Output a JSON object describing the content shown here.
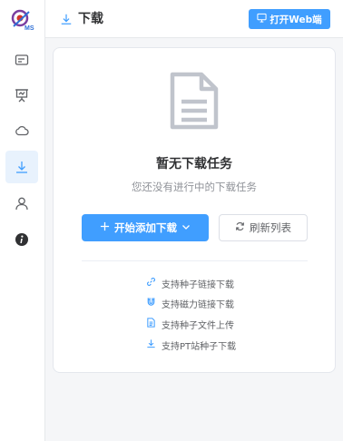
{
  "colors": {
    "accent": "#409eff",
    "active_bg": "#e8f2fd",
    "muted_text": "#909399",
    "icon_gray": "#606266"
  },
  "app": {
    "logo_text": "MS"
  },
  "sidebar": {
    "items": [
      {
        "name": "card-icon"
      },
      {
        "name": "presentation-icon"
      },
      {
        "name": "cloud-icon"
      },
      {
        "name": "download-icon",
        "active": true
      },
      {
        "name": "user-icon"
      },
      {
        "name": "info-icon"
      }
    ]
  },
  "header": {
    "title": "下载",
    "web_button_label": "打开Web端"
  },
  "empty_state": {
    "title": "暂无下载任务",
    "subtitle": "您还没有进行中的下载任务",
    "primary_button_label": "开始添加下载",
    "refresh_button_label": "刷新列表"
  },
  "features": [
    {
      "icon": "link-icon",
      "label": "支持种子链接下载"
    },
    {
      "icon": "magnet-icon",
      "label": "支持磁力链接下载"
    },
    {
      "icon": "file-icon",
      "label": "支持种子文件上传"
    },
    {
      "icon": "download-icon",
      "label": "支持PT站种子下载"
    }
  ]
}
